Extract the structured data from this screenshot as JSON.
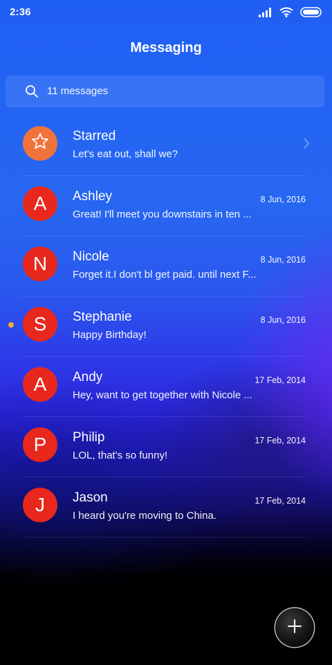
{
  "status_bar": {
    "time": "2:36",
    "icons": [
      "signal-icon",
      "wifi-icon",
      "battery-icon"
    ]
  },
  "header": {
    "title": "Messaging"
  },
  "search": {
    "icon": "search-icon",
    "label": "11 messages"
  },
  "colors": {
    "avatar_red": "#e8281c",
    "starred_avatar": "#f0733c",
    "unread_dot": "#f4a838"
  },
  "conversations": [
    {
      "type": "starred",
      "avatar_icon": "star-icon",
      "name": "Starred",
      "preview": "Let's eat out, shall we?",
      "date": "",
      "unread": false,
      "trailing_icon": "chevron-right-icon"
    },
    {
      "type": "contact",
      "initial": "A",
      "name": "Ashley",
      "preview": "Great! I'll meet you downstairs in ten ...",
      "date": "8 Jun, 2016",
      "unread": false
    },
    {
      "type": "contact",
      "initial": "N",
      "name": "Nicole",
      "preview": "Forget it.I don't bl get paid. until next F...",
      "date": "8 Jun, 2016",
      "unread": false
    },
    {
      "type": "contact",
      "initial": "S",
      "name": "Stephanie",
      "preview": "Happy Birthday!",
      "date": "8 Jun, 2016",
      "unread": true
    },
    {
      "type": "contact",
      "initial": "A",
      "name": "Andy",
      "preview": "Hey, want to get together with Nicole ...",
      "date": "17 Feb, 2014",
      "unread": false
    },
    {
      "type": "contact",
      "initial": "P",
      "name": "Philip",
      "preview": "LOL, that's so funny!",
      "date": "17 Feb, 2014",
      "unread": false
    },
    {
      "type": "contact",
      "initial": "J",
      "name": "Jason",
      "preview": "I heard you're moving to China.",
      "date": "17 Feb, 2014",
      "unread": false
    }
  ],
  "fab": {
    "icon": "plus-icon"
  }
}
